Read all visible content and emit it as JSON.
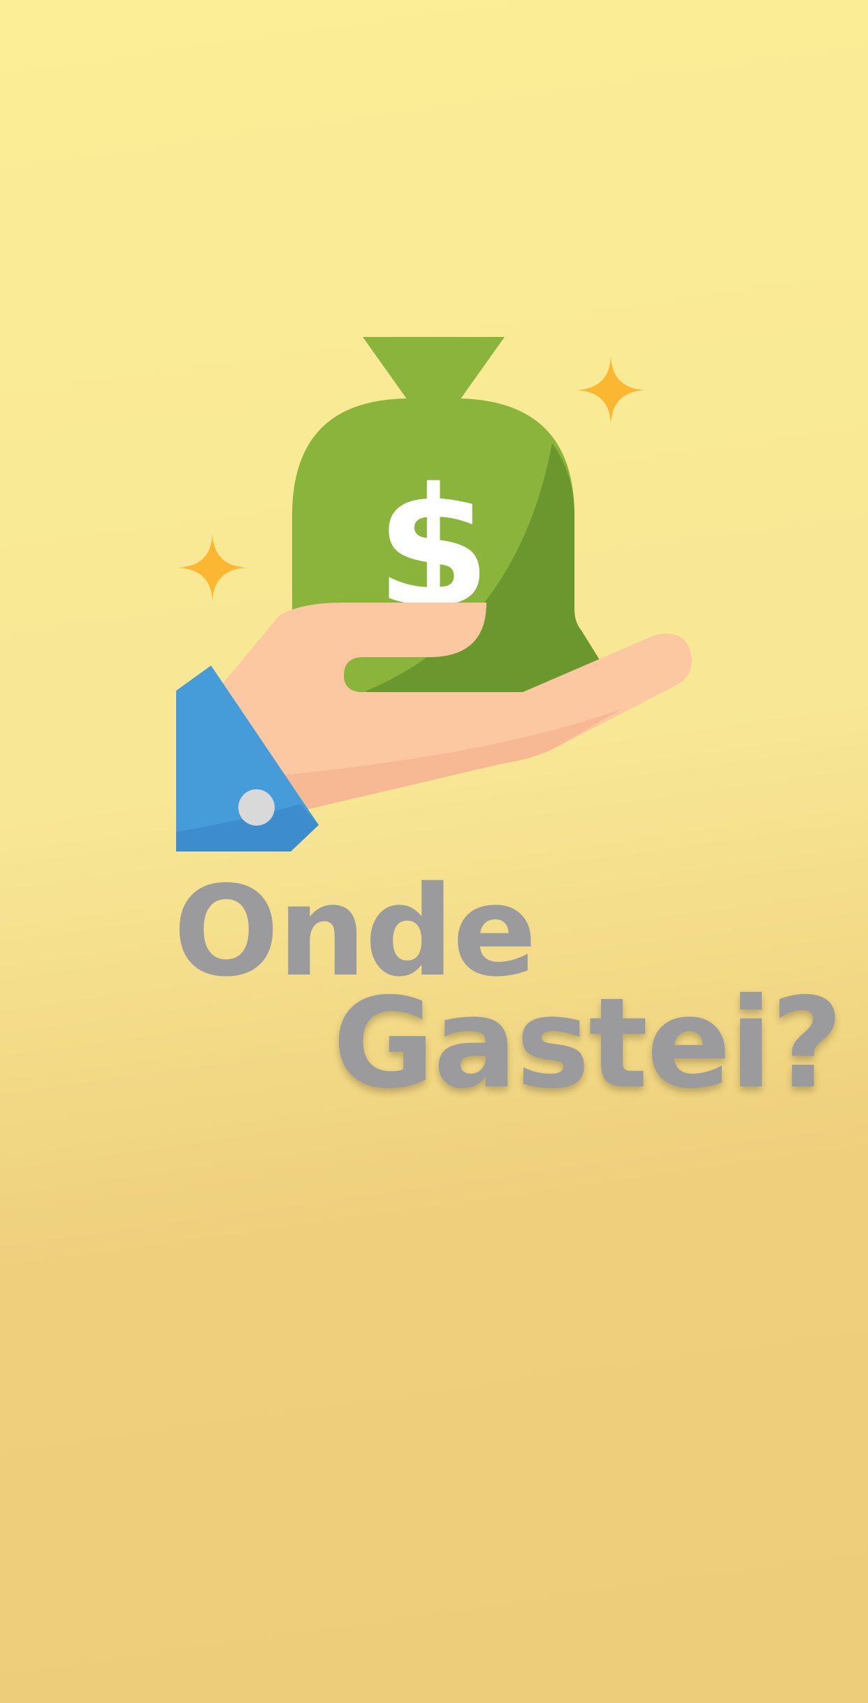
{
  "app": {
    "title_line_1": "Onde",
    "title_line_2": "Gastei?"
  },
  "illustration": {
    "icon": "hand-holding-money-bag-icon",
    "symbol": "$",
    "colors": {
      "background_top": "#fbee96",
      "background_bottom": "#ecce7a",
      "bag": "#8ab43b",
      "bag_shadow": "#6a972e",
      "hand": "#fcc8a1",
      "hand_shadow": "#f6b993",
      "sleeve": "#459cd8",
      "sleeve_shadow": "#3d8ccd",
      "cufflink": "#d9d9d9",
      "sparkle": "#fbb731",
      "title_text": "#9b9b9e"
    }
  }
}
